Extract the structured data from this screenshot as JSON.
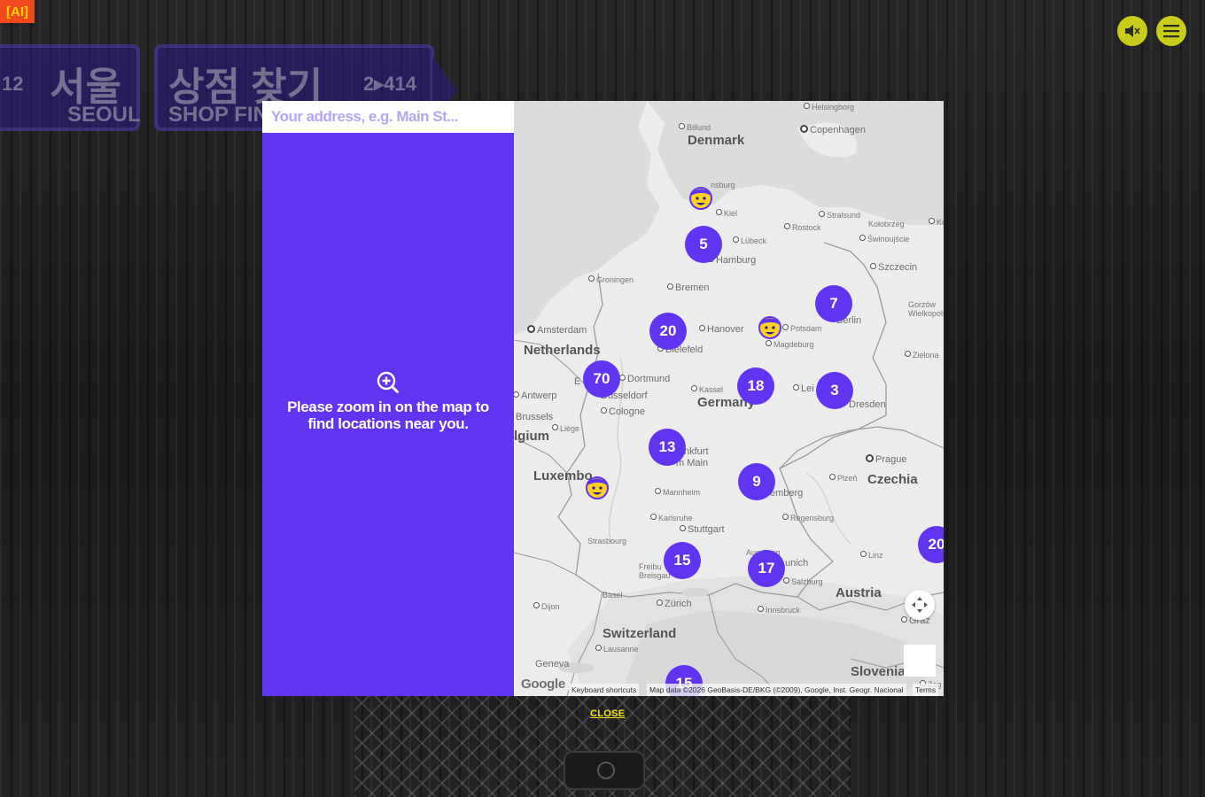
{
  "badge": {
    "label": "[AI]"
  },
  "signs": [
    {
      "number": "12",
      "korean": "서울",
      "english": "SEOUL"
    },
    {
      "korean": "상점 찾기",
      "english": "SHOP FIND",
      "number": "2▸414"
    }
  ],
  "controls": {
    "mute_icon": "speaker-muted-icon",
    "menu_icon": "hamburger-menu-icon"
  },
  "search": {
    "placeholder": "Your address, e.g. Main St..."
  },
  "panel": {
    "zoom_icon": "zoom-in-icon",
    "message_line1": "Please zoom in on the map to",
    "message_line2": "find locations near you."
  },
  "map": {
    "countries": {
      "denmark": "Denmark",
      "netherlands": "Netherlands",
      "belgium": "lgium",
      "germany": "Germany",
      "czechia": "Czechia",
      "austria": "Austria",
      "switzerland": "Switzerland",
      "slovenia": "Slovenia",
      "luxembourg": "Luxembo"
    },
    "cities": {
      "helsingborg": "Helsingborg",
      "billund": "Billund",
      "copenhagen": "Copenhagen",
      "flensburg": "nsburg",
      "kiel": "Kiel",
      "stralsund": "Stralsund",
      "kolobrzeg": "Kołobrzeg",
      "ko": "Ko",
      "rostock": "Rostock",
      "lubeck": "Lübeck",
      "swinoujscie": "Świnoujście",
      "hamburg": "Hamburg",
      "szczecin": "Szczecin",
      "groningen": "Groningen",
      "bremen": "Bremen",
      "gorzow": "Gorzów Wielkopolski",
      "amsterdam": "Amsterdam",
      "hanover": "Hanover",
      "potsdam": "Potsdam",
      "berlin": "Berlin",
      "bielefeld": "Bielefeld",
      "magdeburg": "Magdeburg",
      "zielona": "Zielona",
      "dortmund": "Dortmund",
      "antwerp": "Antwerp",
      "essen": "E",
      "dusseldorf": "Dusseldorf",
      "kassel": "Kassel",
      "leipzig": "Lei",
      "brussels": "Brussels",
      "cologne": "Cologne",
      "dresden": "Dresden",
      "liege": "Liège",
      "frankfurt1": "nkfurt",
      "frankfurt2": "m Main",
      "prague": "Prague",
      "plzen": "Plzeň",
      "mannheim": "Mannheim",
      "nuremberg": "emberg",
      "karlsruhe": "Karlsruhe",
      "regensburg": "Regensburg",
      "stuttgart": "Stuttgart",
      "strasbourg": "Strasbourg",
      "augsburg": "Augsburg",
      "linz": "Linz",
      "munich": "unich",
      "freiburg1": "Freibu",
      "freiburg2": "Breisgau",
      "basel": "Basel",
      "salzburg": "Salzburg",
      "dijon": "Dijon",
      "zurich": "Zürich",
      "innsbruck": "Innsbruck",
      "graz": "Graz",
      "lausanne": "Lausanne",
      "geneva": "Geneva",
      "zagreb": "Zag"
    },
    "clusters": [
      "5",
      "7",
      "20",
      "70",
      "18",
      "3",
      "13",
      "9",
      "15",
      "17",
      "20",
      "15"
    ],
    "marker_icon": "character-face-marker-icon",
    "recenter_icon": "recenter-arrows-icon",
    "google": "Google",
    "keyboard": "Keyboard shortcuts",
    "map_data": "Map data ©2026 GeoBasis-DE/BKG (©2009), Google, Inst. Geogr. Nacional",
    "terms": "Terms"
  },
  "close": {
    "label": "CLOSE"
  },
  "colors": {
    "accent": "#6134f2",
    "close_yellow": "#f5e20a",
    "control_yellow": "#c9cc1a",
    "badge_orange": "#f04a1c"
  }
}
